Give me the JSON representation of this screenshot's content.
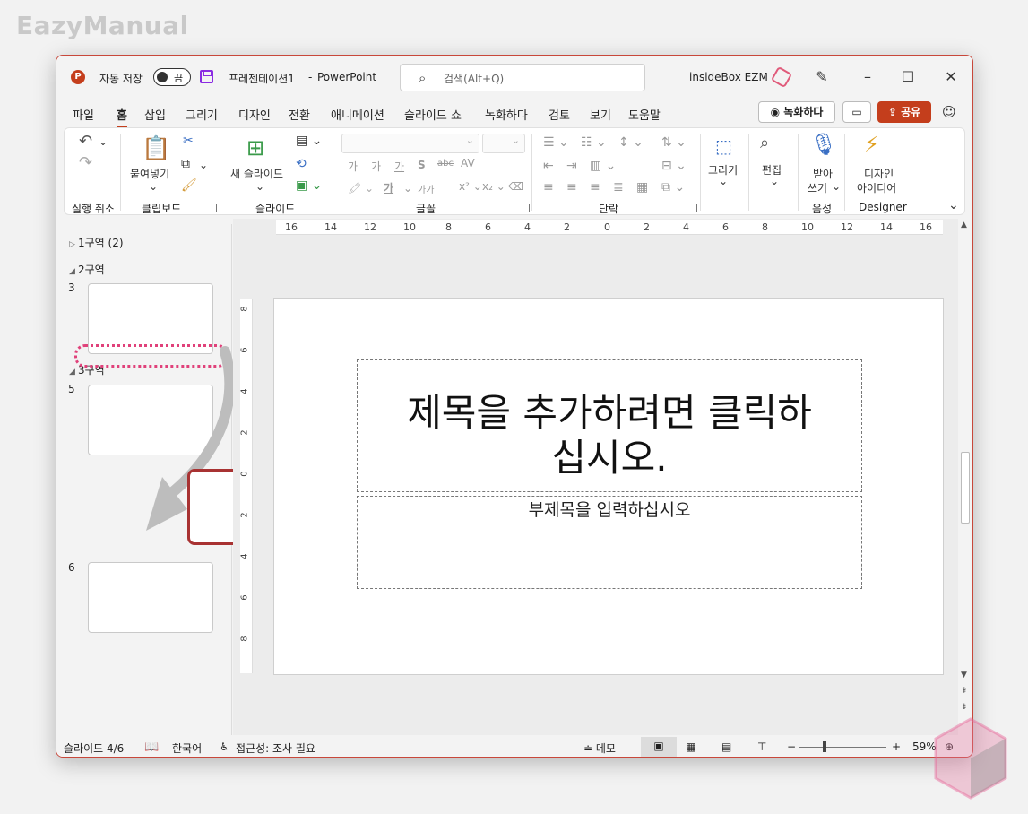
{
  "watermark": "EazyManual",
  "titlebar": {
    "autosave_label": "자동 저장",
    "autosave_state": "끔",
    "doc_title": "프레젠테이션1",
    "separator": "-",
    "app_name": "PowerPoint",
    "search_placeholder": "검색(Alt+Q)",
    "account": "insideBox EZM"
  },
  "tabs": [
    "파일",
    "홈",
    "삽입",
    "그리기",
    "디자인",
    "전환",
    "애니메이션",
    "슬라이드 쇼",
    "녹화하다",
    "검토",
    "보기",
    "도움말"
  ],
  "active_tab": "홈",
  "right_buttons": {
    "record": "녹화하다",
    "share": "공유"
  },
  "ribbon": {
    "groups": [
      {
        "label": "실행 취소"
      },
      {
        "label": "클립보드"
      },
      {
        "label": "슬라이드"
      },
      {
        "label": "글꼴"
      },
      {
        "label": "단락"
      },
      {
        "label": "음성"
      },
      {
        "label": "Designer"
      }
    ],
    "paste": "붙여넣기",
    "new_slide": "새 슬라이드",
    "draw": "그리기",
    "edit": "편집",
    "dictate_1": "받아",
    "dictate_2": "쓰기",
    "designer_1": "디자인",
    "designer_2": "아이디어",
    "font_btns": [
      "가",
      "가",
      "가",
      "S",
      "abc",
      "AV",
      "가",
      "가",
      "가가"
    ]
  },
  "left_pane": {
    "sections": [
      {
        "label": "1구역 (2)",
        "collapsed": true
      },
      {
        "label": "2구역",
        "collapsed": false
      },
      {
        "label": "3구역",
        "collapsed": false
      }
    ],
    "slides": [
      "3",
      "5",
      "6"
    ]
  },
  "ruler": {
    "h_ticks": [
      "16",
      "14",
      "12",
      "10",
      "8",
      "6",
      "4",
      "2",
      "0",
      "2",
      "4",
      "6",
      "8",
      "10",
      "12",
      "14",
      "16"
    ],
    "v_ticks": [
      "8",
      "6",
      "4",
      "2",
      "0",
      "2",
      "4",
      "6",
      "8"
    ]
  },
  "slide": {
    "title_line1": "제목을 추가하려면 클릭하",
    "title_line2": "십시오.",
    "subtitle": "부제목을 입력하십시오"
  },
  "statusbar": {
    "slide_pos": "슬라이드 4/6",
    "language": "한국어",
    "accessibility": "접근성: 조사 필요",
    "notes": "메모",
    "zoom": "59%"
  }
}
